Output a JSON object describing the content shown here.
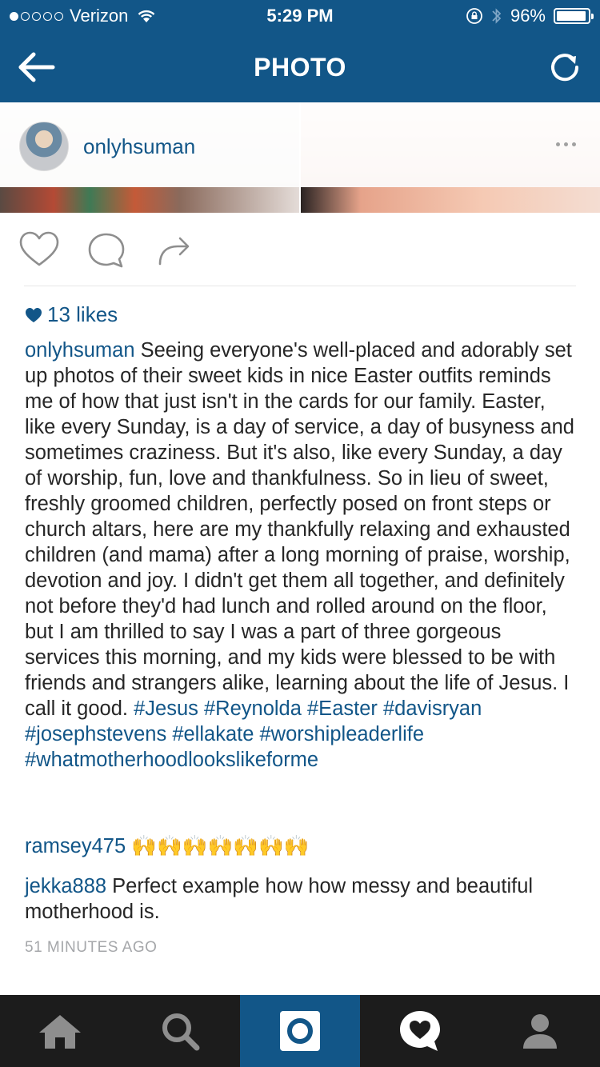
{
  "status_bar": {
    "carrier": "Verizon",
    "signal_bars": 1,
    "signal_total": 5,
    "time": "5:29 PM",
    "battery": "96%",
    "battery_level": 0.96
  },
  "nav": {
    "title": "PHOTO",
    "back_icon": "back-arrow-icon",
    "refresh_icon": "refresh-icon"
  },
  "post": {
    "username": "onlyhsuman",
    "more_icon": "more-icon"
  },
  "actions": {
    "like_icon": "heart-icon",
    "comment_icon": "comment-icon",
    "share_icon": "share-icon"
  },
  "likes": "13 likes",
  "caption": {
    "username": "onlyhsuman",
    "text": "Seeing everyone's well-placed and adorably set up photos of their sweet kids in nice Easter outfits reminds me of how that just isn't in the cards for our family. Easter, like every Sunday, is a day of service, a day of busyness and sometimes craziness. But it's also, like every Sunday, a day of worship, fun, love and thankfulness. So in lieu of sweet, freshly groomed children, perfectly posed on front steps or church altars, here are my thankfully relaxing and exhausted children (and mama) after a long morning of praise, worship, devotion and joy. I didn't get them all together, and definitely not before they'd had lunch and rolled around on the floor, but I am thrilled to say I was a part of three gorgeous services this morning, and my kids were blessed to be with friends and strangers alike, learning about the life of Jesus. I call it good.",
    "hashtags": [
      "#Jesus",
      "#Reynolda",
      "#Easter",
      "#davisryan",
      "#josephstevens",
      "#ellakate",
      "#worshipleaderlife",
      "#whatmotherhoodlookslikeforme"
    ]
  },
  "comments": [
    {
      "username": "ramsey475",
      "text": "🙌🙌🙌🙌🙌🙌🙌"
    },
    {
      "username": "jekka888",
      "text": "Perfect example how how messy and beautiful motherhood is."
    }
  ],
  "timestamp": "51 MINUTES AGO",
  "tabbar": [
    {
      "icon": "home-icon",
      "active": false
    },
    {
      "icon": "search-icon",
      "active": false
    },
    {
      "icon": "camera-icon",
      "active": true
    },
    {
      "icon": "activity-icon",
      "active": false
    },
    {
      "icon": "profile-icon",
      "active": false
    }
  ],
  "colors": {
    "brand": "#125688",
    "tabbar": "#1c1c1c",
    "text": "#262626",
    "muted": "#a5a7aa"
  }
}
